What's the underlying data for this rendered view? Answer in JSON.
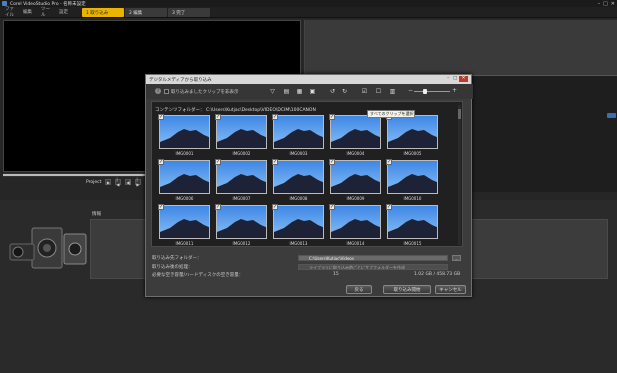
{
  "app": {
    "title": "Corel VideoStudio Pro - 名称未設定"
  },
  "window_controls": {
    "minimize": "–",
    "maximize": "□",
    "close": "✕"
  },
  "menubar": {
    "items": [
      "ファイル",
      "編集",
      "ツール",
      "設定"
    ]
  },
  "steps": [
    {
      "label": "1 取り込み",
      "active": true
    },
    {
      "label": "2 編集",
      "active": false
    },
    {
      "label": "3 完了",
      "active": false
    }
  ],
  "player": {
    "mode_label": "Project",
    "buttons": [
      "▶",
      "|◀",
      "◀|",
      "|▶",
      "▶|"
    ]
  },
  "info": {
    "label": "情報"
  },
  "dialog": {
    "title": "デジタルメディアから取り込み",
    "close": "✕",
    "maximize": "□",
    "minimize": "–",
    "help": "?",
    "hide_imported_label": "取り込みましたクリップを非表示",
    "tooltip": "すべてのクリップを選択",
    "folder_label": "コンテンツフォルダー：",
    "folder_path": "C:\\Users\\Kutjac\\Desktop\\VIDEO\\DCIM\\100CANON",
    "clips": [
      {
        "name": "IMG0001",
        "checked": true
      },
      {
        "name": "IMG0002",
        "checked": true
      },
      {
        "name": "IMG0003",
        "checked": true
      },
      {
        "name": "IMG0004",
        "checked": true
      },
      {
        "name": "IMG0005",
        "checked": true
      },
      {
        "name": "IMG0006",
        "checked": true
      },
      {
        "name": "IMG0007",
        "checked": true
      },
      {
        "name": "IMG0008",
        "checked": true
      },
      {
        "name": "IMG0009",
        "checked": true
      },
      {
        "name": "IMG0010",
        "checked": true
      },
      {
        "name": "IMG0011",
        "checked": true
      },
      {
        "name": "IMG0012",
        "checked": true
      },
      {
        "name": "IMG0013",
        "checked": true
      },
      {
        "name": "IMG0014",
        "checked": true
      },
      {
        "name": "IMG0015",
        "checked": true
      }
    ],
    "dest_label": "取り込み先フォルダー：",
    "dest_value": "C:\\Users\\Kutjac\\Videos",
    "browse": "…",
    "settings_label": "取り込み後の処理：",
    "settings_value": "ライブラリに取り込み時ごとにサブフォルダーを作成",
    "space_label": "必要な空き容量/ハードディスクの空き容量：",
    "space_count": "15",
    "space_size": "1.02 GB / 458.73 GB",
    "buttons": {
      "back": "戻る",
      "start": "取り込み開始",
      "cancel": "キャンセル"
    }
  }
}
